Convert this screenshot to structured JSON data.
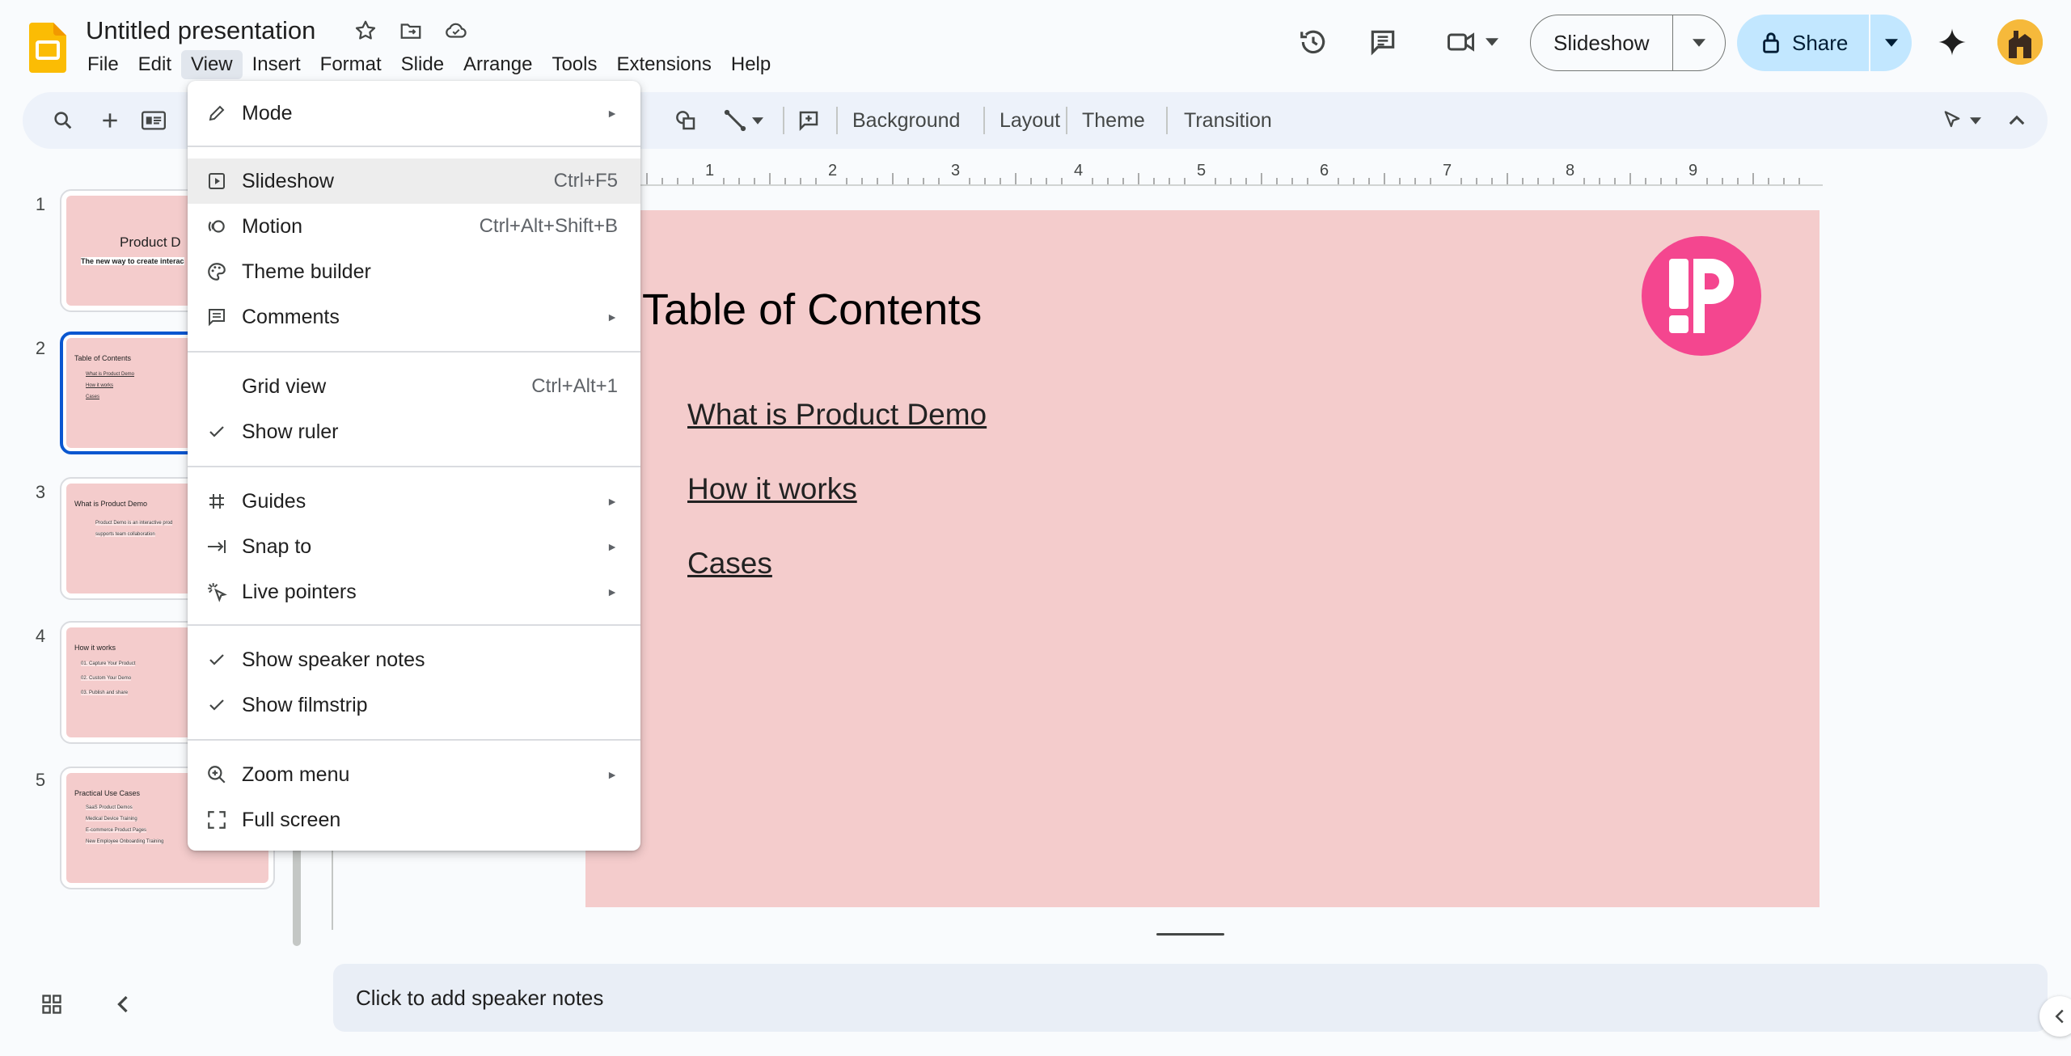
{
  "app": {
    "doc_title": "Untitled presentation",
    "menus": [
      "File",
      "Edit",
      "View",
      "Insert",
      "Format",
      "Slide",
      "Arrange",
      "Tools",
      "Extensions",
      "Help"
    ],
    "active_menu": "View"
  },
  "header_right": {
    "slideshow_label": "Slideshow",
    "share_label": "Share"
  },
  "toolbar": {
    "background": "Background",
    "layout": "Layout",
    "theme": "Theme",
    "transition": "Transition"
  },
  "view_menu": {
    "items": [
      {
        "label": "Mode",
        "shortcut": "",
        "submenu": true,
        "icon": "pencil-icon"
      },
      {
        "label": "Slideshow",
        "shortcut": "Ctrl+F5",
        "submenu": false,
        "icon": "play-box-icon"
      },
      {
        "label": "Motion",
        "shortcut": "Ctrl+Alt+Shift+B",
        "submenu": false,
        "icon": "motion-icon"
      },
      {
        "label": "Theme builder",
        "shortcut": "",
        "submenu": false,
        "icon": "palette-icon"
      },
      {
        "label": "Comments",
        "shortcut": "",
        "submenu": true,
        "icon": "comment-icon"
      },
      {
        "label": "Grid view",
        "shortcut": "Ctrl+Alt+1",
        "submenu": false,
        "icon": ""
      },
      {
        "label": "Show ruler",
        "shortcut": "",
        "submenu": false,
        "icon": "check-icon"
      },
      {
        "label": "Guides",
        "shortcut": "",
        "submenu": true,
        "icon": "hash-icon"
      },
      {
        "label": "Snap to",
        "shortcut": "",
        "submenu": true,
        "icon": "snap-icon"
      },
      {
        "label": "Live pointers",
        "shortcut": "",
        "submenu": true,
        "icon": "pointer-icon"
      },
      {
        "label": "Show speaker notes",
        "shortcut": "",
        "submenu": false,
        "icon": "check-icon"
      },
      {
        "label": "Show filmstrip",
        "shortcut": "",
        "submenu": false,
        "icon": "check-icon"
      },
      {
        "label": "Zoom menu",
        "shortcut": "",
        "submenu": true,
        "icon": "zoom-in-icon"
      },
      {
        "label": "Full screen",
        "shortcut": "",
        "submenu": false,
        "icon": "fullscreen-icon"
      }
    ],
    "arrow": "►"
  },
  "filmstrip": {
    "numbers": [
      "1",
      "2",
      "3",
      "4",
      "5"
    ],
    "slides": [
      {
        "title": "Product D",
        "subtitle": "The new way to create interac"
      },
      {
        "title": "Table of Contents",
        "lines": [
          "What is Product Demo",
          "How it works",
          "Cases"
        ]
      },
      {
        "title": "What is Product Demo",
        "lines": [
          "Product Demo is an interactive prod",
          "supports team collaboration"
        ]
      },
      {
        "title": "How it works",
        "lines": [
          "01. Capture Your Product",
          "02. Custom Your Demo",
          "03. Publish and share"
        ]
      },
      {
        "title": "Practical Use Cases",
        "lines": [
          "SaaS Product Demos",
          "Medical Device Training",
          "E-commerce Product Pages",
          "New Employee Onboarding Training"
        ]
      }
    ],
    "selected_index": 1
  },
  "ruler": {
    "labels": [
      "1",
      "2",
      "3",
      "4",
      "5",
      "6",
      "7",
      "8",
      "9"
    ]
  },
  "slide": {
    "title": "Table of Contents",
    "links": [
      "What is Product Demo",
      "How it works",
      "Cases"
    ],
    "bg_color": "#f4cccc",
    "logo_color": "#f4468f"
  },
  "speaker_notes": {
    "placeholder": "Click to add speaker notes"
  },
  "colors": {
    "accent": "#0b57d0",
    "share_bg": "#c2e7ff",
    "toolbar_bg": "#edf2fa"
  }
}
